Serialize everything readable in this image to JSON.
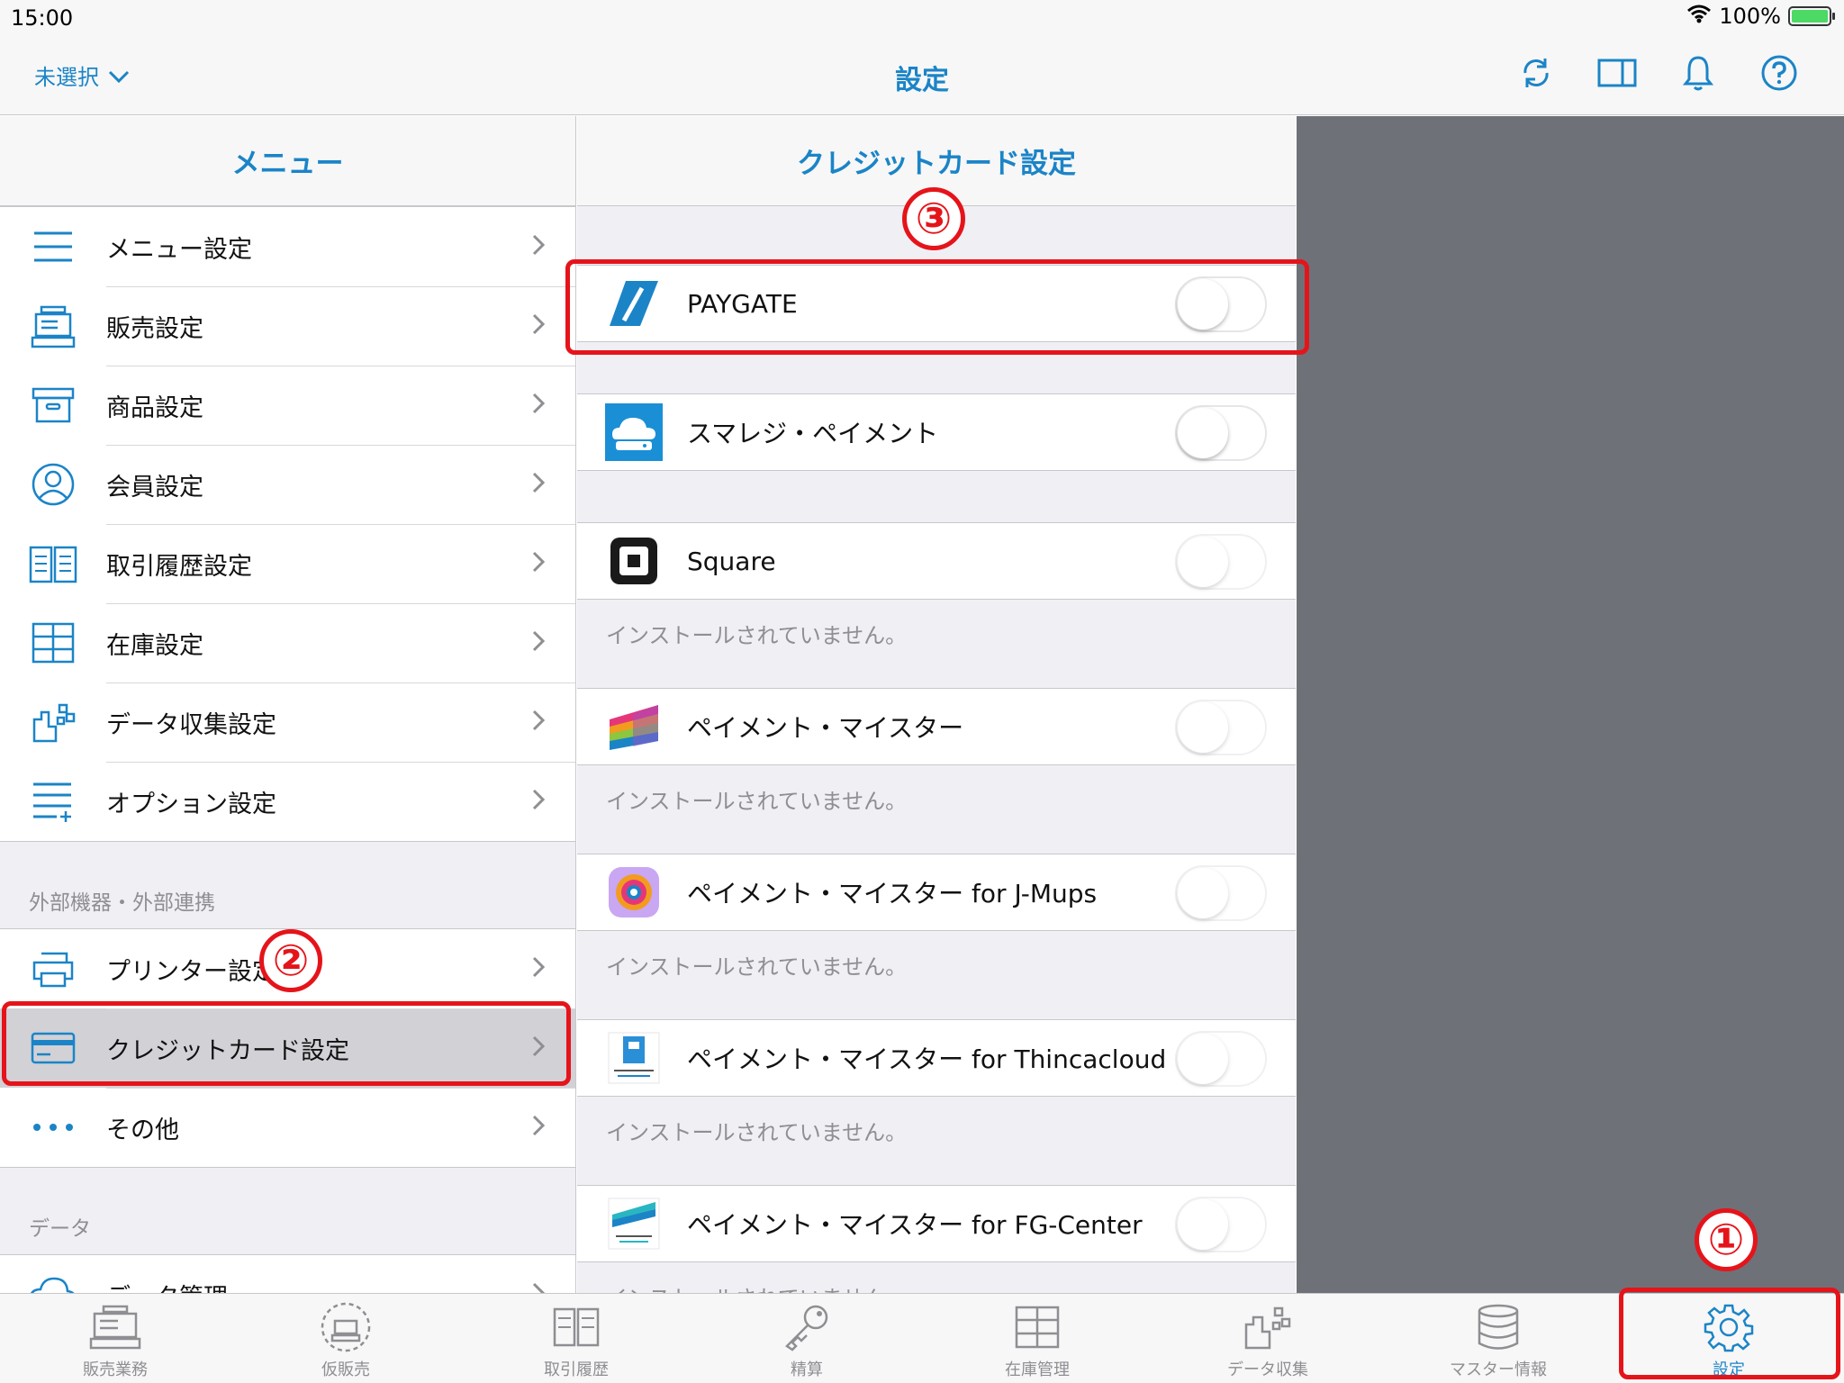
{
  "status_bar": {
    "time": "15:00",
    "battery": "100%"
  },
  "nav": {
    "left_label": "未選択",
    "title": "設定",
    "icons": [
      "sync-icon",
      "split-view-icon",
      "bell-icon",
      "help-icon"
    ]
  },
  "menu": {
    "header": "メニュー",
    "items": [
      {
        "label": "メニュー設定",
        "icon": "list-icon"
      },
      {
        "label": "販売設定",
        "icon": "register-icon"
      },
      {
        "label": "商品設定",
        "icon": "box-icon"
      },
      {
        "label": "会員設定",
        "icon": "person-icon"
      },
      {
        "label": "取引履歴設定",
        "icon": "book-icon"
      },
      {
        "label": "在庫設定",
        "icon": "shelves-icon"
      },
      {
        "label": "データ収集設定",
        "icon": "data-icon"
      },
      {
        "label": "オプション設定",
        "icon": "list-plus-icon"
      }
    ],
    "external_section_title": "外部機器・外部連携",
    "external_items": [
      {
        "label": "プリンター設定",
        "icon": "printer-icon"
      },
      {
        "label": "クレジットカード設定",
        "icon": "credit-card-icon"
      },
      {
        "label": "その他",
        "icon": "more-icon"
      }
    ],
    "data_section_title": "データ",
    "data_items": [
      {
        "label": "データ管理",
        "icon": "cloud-sync-icon"
      }
    ]
  },
  "credit": {
    "header": "クレジットカード設定",
    "rows": [
      {
        "label": "PAYGATE",
        "note": ""
      },
      {
        "label": "スマレジ・ペイメント",
        "note": ""
      },
      {
        "label": "Square",
        "note": "インストールされていません。"
      },
      {
        "label": "ペイメント・マイスター",
        "note": "インストールされていません。"
      },
      {
        "label": "ペイメント・マイスター for J-Mups",
        "note": "インストールされていません。"
      },
      {
        "label": "ペイメント・マイスター for Thincacloud",
        "note": "インストールされていません。"
      },
      {
        "label": "ペイメント・マイスター for FG-Center",
        "note": "インストールされていません。"
      }
    ]
  },
  "tabs": [
    {
      "label": "販売業務"
    },
    {
      "label": "仮販売"
    },
    {
      "label": "取引履歴"
    },
    {
      "label": "精算"
    },
    {
      "label": "在庫管理"
    },
    {
      "label": "データ収集"
    },
    {
      "label": "マスター情報"
    },
    {
      "label": "設定"
    }
  ],
  "annotations": {
    "one": "①",
    "two": "②",
    "three": "③"
  },
  "colors": {
    "accent": "#1b84c7",
    "annotation": "#e5141a",
    "detail_bg": "#6f7178"
  }
}
